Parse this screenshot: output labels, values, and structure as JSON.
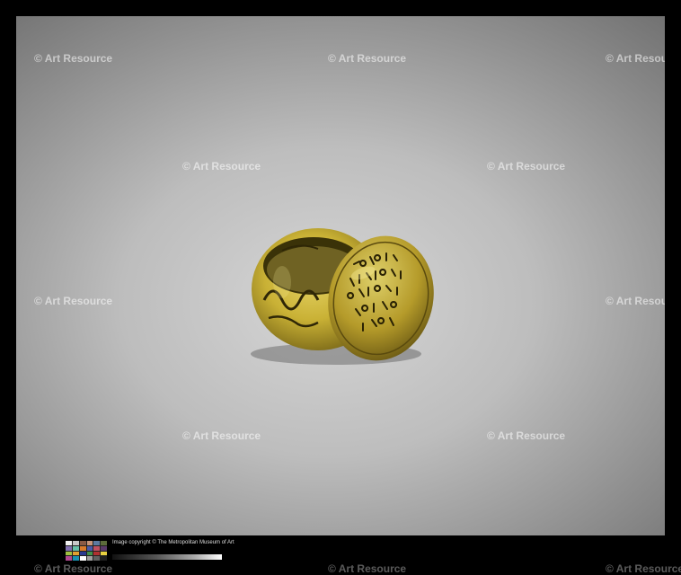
{
  "watermark": "© Art Resource",
  "footer": {
    "copyright": "Image copyright © The Metropolitan Museum of Art"
  },
  "colors": {
    "background": "#000000",
    "gold": "#c9b135",
    "gold_dark": "#6b5a12"
  },
  "colorchecker_swatches": [
    "#f2f2f2",
    "#c8c8c8",
    "#8a5a44",
    "#c89478",
    "#5d7aa0",
    "#5c6b3a",
    "#8270b0",
    "#66c0a8",
    "#d97a2a",
    "#4a5aa8",
    "#c05060",
    "#5a3a6a",
    "#a0c040",
    "#e0a030",
    "#2a3a90",
    "#40904a",
    "#b03030",
    "#e8d040",
    "#b04890",
    "#1890b0",
    "#ffffff",
    "#a0a0a0",
    "#606060",
    "#202020"
  ]
}
